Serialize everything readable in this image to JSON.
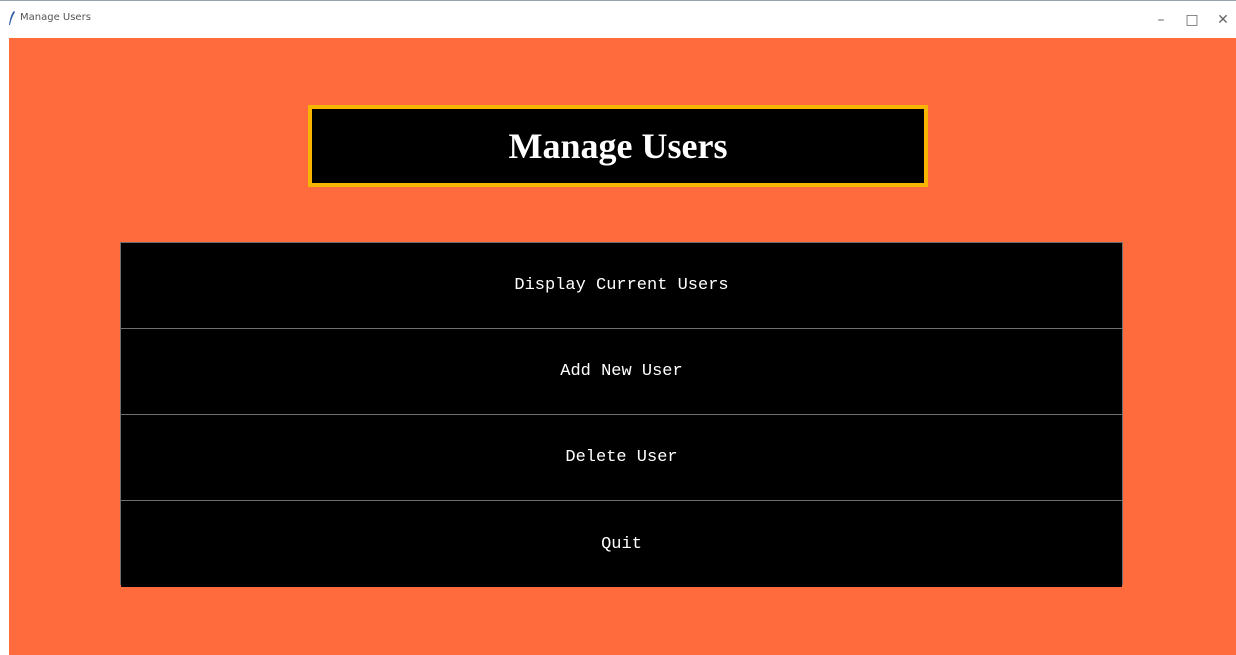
{
  "window": {
    "title": "Manage Users"
  },
  "header": {
    "title": "Manage Users"
  },
  "menu": {
    "items": [
      {
        "label": "Display Current Users"
      },
      {
        "label": "Add New User"
      },
      {
        "label": "Delete User"
      },
      {
        "label": "Quit"
      }
    ]
  },
  "colors": {
    "background": "#ff6b3d",
    "header_border": "#f7b400",
    "button_bg": "#000000",
    "button_text": "#ffffff"
  },
  "icons": {
    "app": "feather-icon",
    "minimize": "minimize-icon",
    "maximize": "maximize-icon",
    "close": "close-icon"
  }
}
